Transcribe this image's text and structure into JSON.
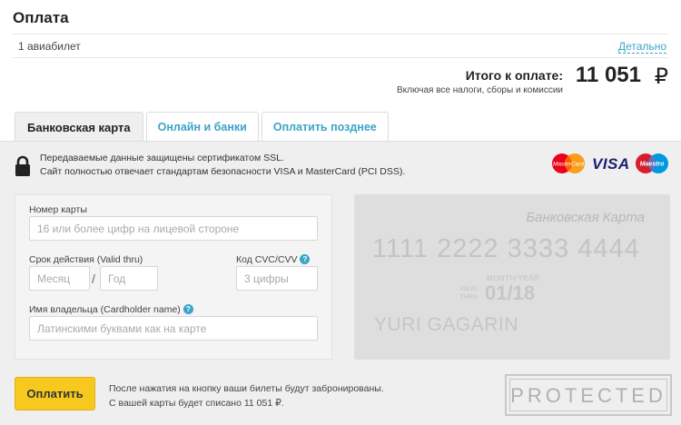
{
  "header": {
    "title": "Оплата",
    "ticket_label": "1 авиабилет",
    "details_link": "Детально"
  },
  "total": {
    "label": "Итого к оплате:",
    "amount": "11 051",
    "currency": "₽",
    "note": "Включая все налоги, сборы и комиссии"
  },
  "tabs": [
    {
      "label": "Банковская карта",
      "active": true
    },
    {
      "label": "Онлайн и банки",
      "active": false
    },
    {
      "label": "Оплатить позднее",
      "active": false
    }
  ],
  "ssl": {
    "line1": "Передаваемые данные защищены сертификатом SSL.",
    "line2": "Сайт полностью отвечает стандартам безопасности VISA и MasterCard (PCI DSS)."
  },
  "logos": {
    "mastercard": "MasterCard",
    "visa": "VISA",
    "maestro": "Maestro"
  },
  "form": {
    "card_number_label": "Номер карты",
    "card_number_placeholder": "16 или более цифр на лицевой стороне",
    "expiry_label": "Срок действия (Valid thru)",
    "month_placeholder": "Месяц",
    "separator": "/",
    "year_placeholder": "Год",
    "cvc_label": "Код CVC/CVV",
    "cvc_placeholder": "3 цифры",
    "holder_label": "Имя владельца (Cardholder name)",
    "holder_placeholder": "Латинскими буквами как на карте",
    "help_glyph": "?"
  },
  "card_preview": {
    "title": "Банковская Карта",
    "number": "1111 2222 3333 4444",
    "month_year_caption": "MONTH/YEAR",
    "valid_caption_1": "VALID",
    "valid_caption_2": "THRU",
    "expiry": "01/18",
    "holder": "YURI GAGARIN"
  },
  "pay": {
    "button_label": "Оплатить",
    "note_line1": "После нажатия на кнопку ваши билеты будут забронированы.",
    "note_line2": "С вашей карты будет списано 11 051 ₽."
  },
  "badge": {
    "text": "PROTECTED"
  },
  "colors": {
    "accent": "#3ba4c8",
    "pay_button": "#f7c81e",
    "panel": "#efefef"
  }
}
